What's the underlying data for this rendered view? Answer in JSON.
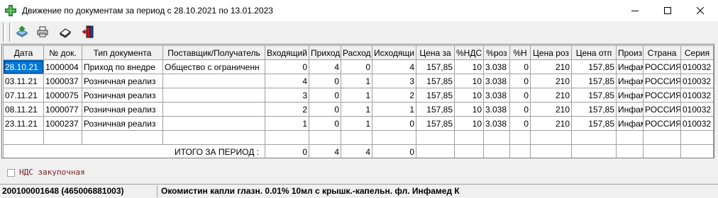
{
  "window": {
    "title": "Движение по документам за период с 28.10.2021 по 13.01.2023",
    "controls": [
      "minimize",
      "maximize",
      "close"
    ],
    "icon": "green-cross-icon",
    "accent": "#2e9e3a"
  },
  "toolbar": {
    "buttons": [
      {
        "icon": "open-document-icon"
      },
      {
        "icon": "printer-icon"
      },
      {
        "icon": "eraser-icon"
      },
      {
        "icon": "exit-door-icon"
      }
    ]
  },
  "grid": {
    "columns": [
      "Дата",
      "№ док.",
      "Тип документа",
      "Поставщик/Получатель",
      "Входящий",
      "Приход",
      "Расход",
      "Исходящи",
      "Цена за",
      "%НДС",
      "%роз",
      "%Н",
      "Цена роз",
      "Цена отп",
      "Произ",
      "Страна",
      "Серия"
    ],
    "rows": [
      [
        "28.10.21",
        "1000004",
        "Приход по внедре",
        "Общество с ограниченн",
        "0",
        "4",
        "0",
        "4",
        "157,85",
        "10",
        "3.038",
        "0",
        "210",
        "157,85",
        "Инфам",
        "РОССИЯ",
        "010032"
      ],
      [
        "03.11.21",
        "1000037",
        "Розничная реализ",
        "",
        "4",
        "0",
        "1",
        "3",
        "157,85",
        "10",
        "3.038",
        "0",
        "210",
        "157,85",
        "Инфам",
        "РОССИЯ",
        "010032"
      ],
      [
        "07.11.21",
        "1000075",
        "Розничная реализ",
        "",
        "3",
        "0",
        "1",
        "2",
        "157,85",
        "10",
        "3.038",
        "0",
        "210",
        "157,85",
        "Инфам",
        "РОССИЯ",
        "010032"
      ],
      [
        "08.11.21",
        "1000077",
        "Розничная реализ",
        "",
        "2",
        "0",
        "1",
        "1",
        "157,85",
        "10",
        "3.038",
        "0",
        "210",
        "157,85",
        "Инфам",
        "РОССИЯ",
        "010032"
      ],
      [
        "23.11.21",
        "1000237",
        "Розничная реализ",
        "",
        "1",
        "0",
        "1",
        "0",
        "157,85",
        "10",
        "3.038",
        "0",
        "210",
        "157,85",
        "Инфам",
        "РОССИЯ",
        "010032"
      ]
    ],
    "total": {
      "label": "ИТОГО ЗА ПЕРИОД :",
      "values": [
        "0",
        "4",
        "4",
        "0"
      ]
    },
    "selection_color": "#0078d7"
  },
  "options": {
    "nds_label": "НДС закупочная",
    "nds_checked": false
  },
  "statusbar": {
    "code": "200100001648 (465006881003)",
    "product": "Окомистин капли глазн. 0.01% 10мл с крышк.-капельн. фл. Инфамед К"
  }
}
